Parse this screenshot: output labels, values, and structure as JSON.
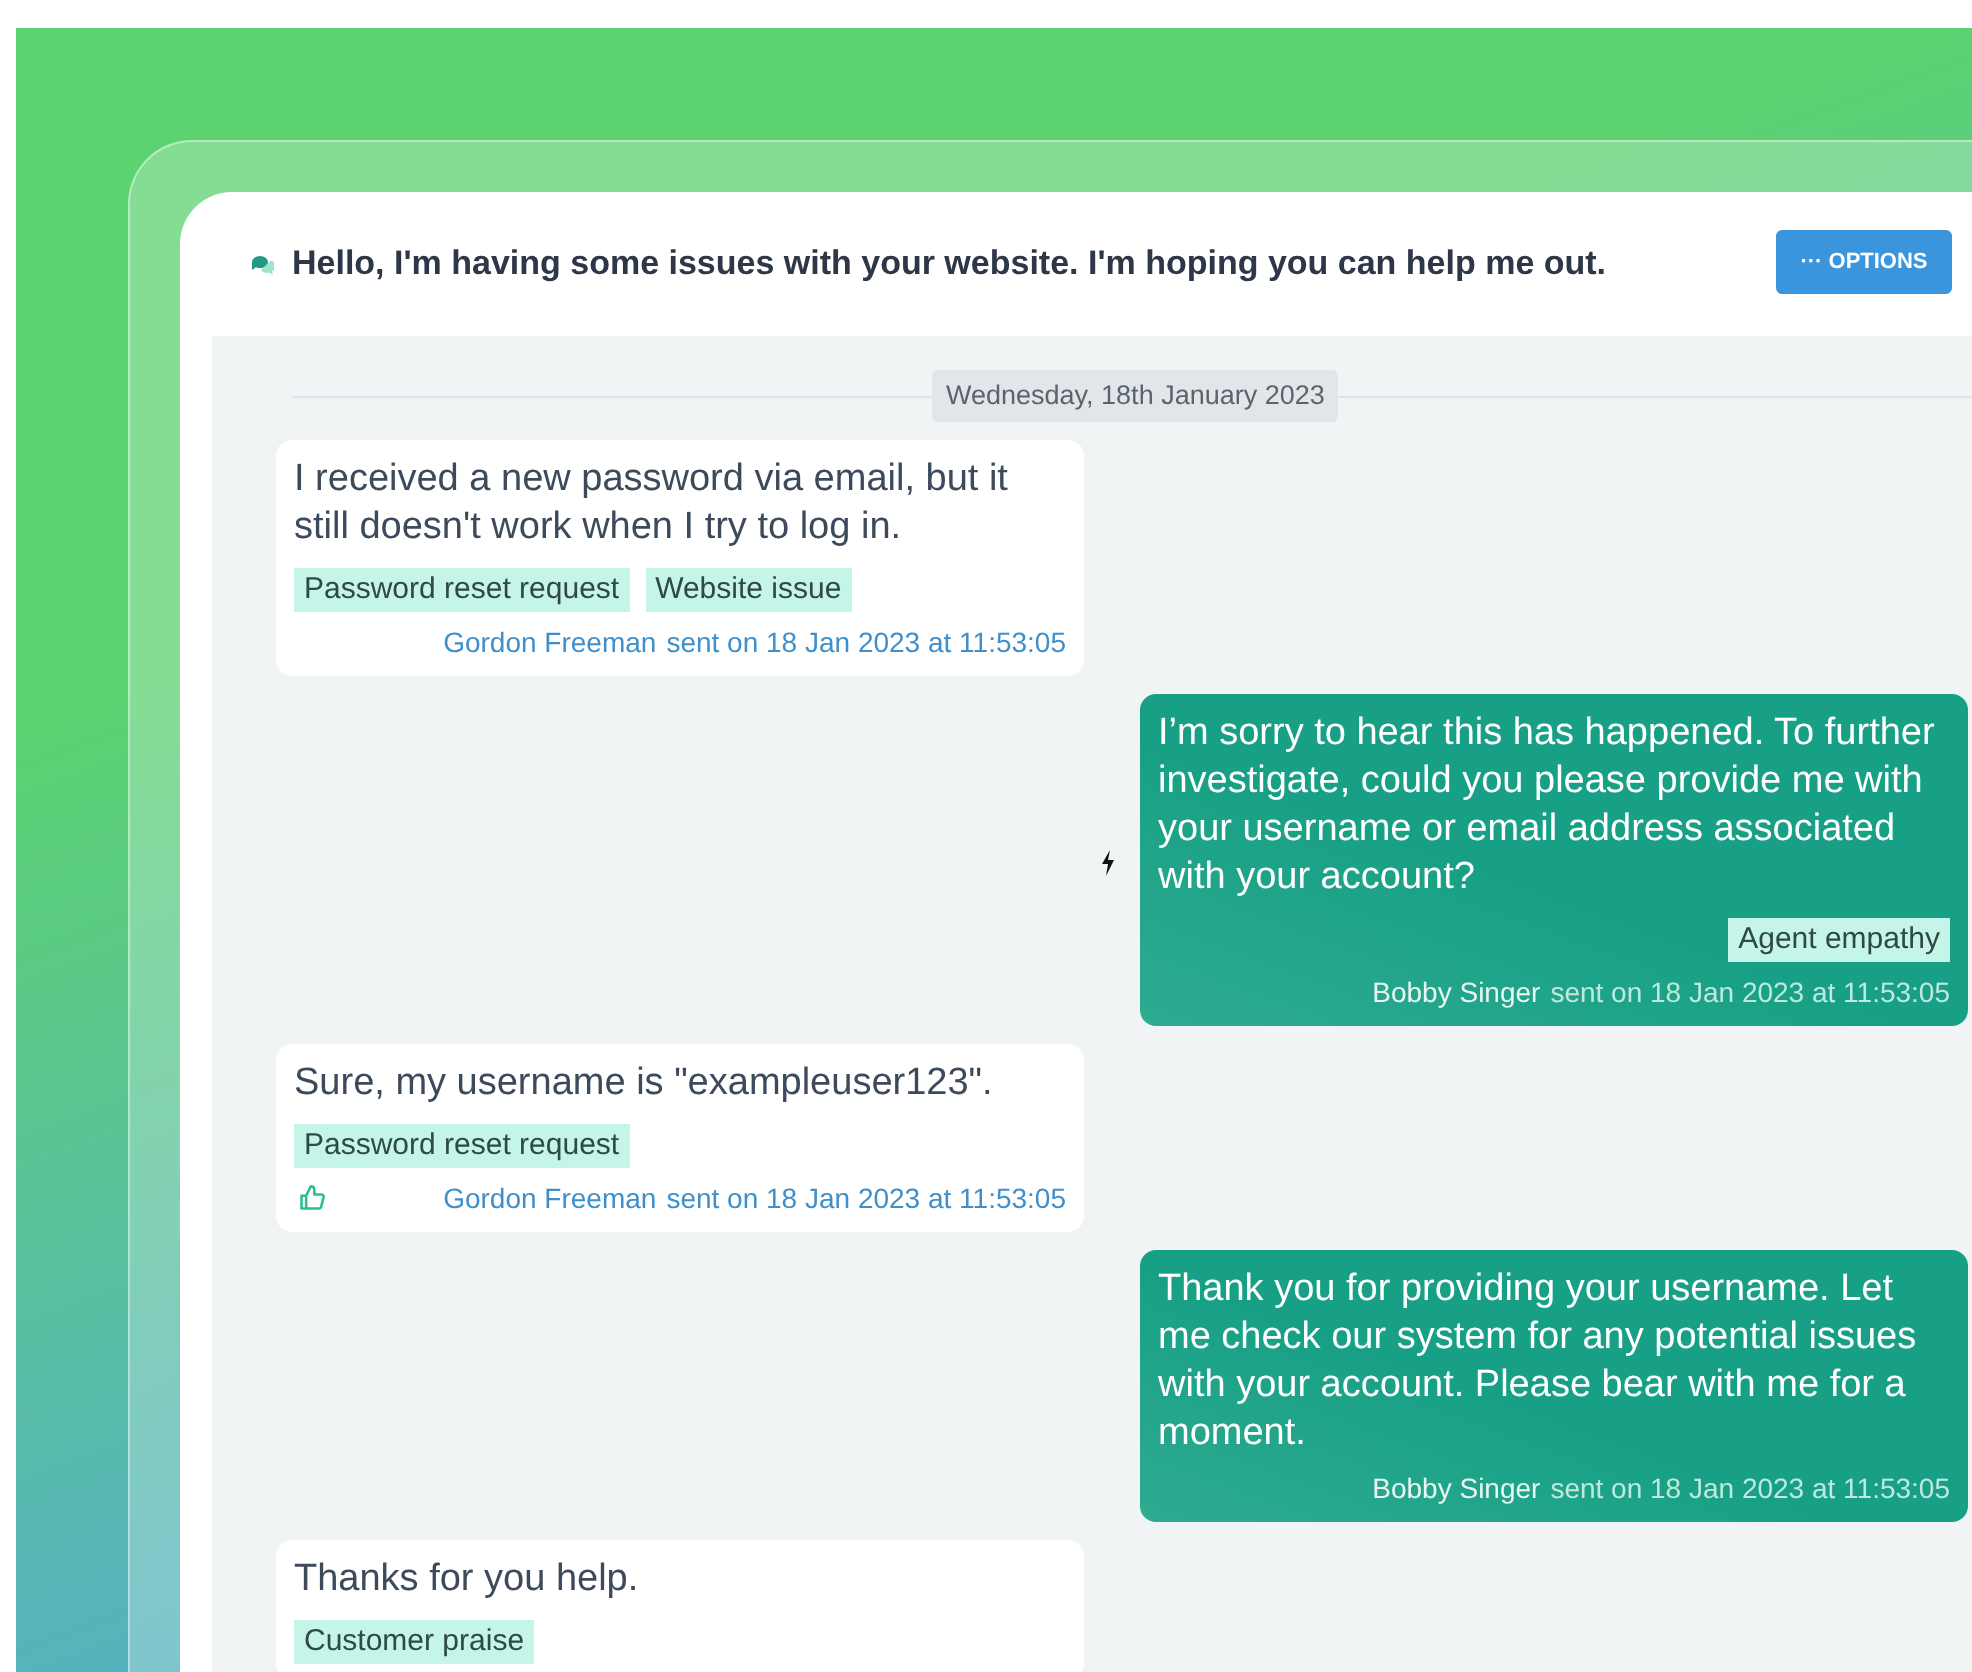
{
  "header": {
    "title": "Hello, I'm having some issues with your website. I'm hoping you can help me out.",
    "options_button": "··· OPTIONS"
  },
  "date_separator": "Wednesday, 18th January 2023",
  "messages": [
    {
      "kind": "customer",
      "text": "I received a new password via email, but it still doesn't work when I try to log in.",
      "tags": [
        "Password reset request",
        "Website issue"
      ],
      "author": "Gordon Freeman",
      "sent": "sent on 18 Jan 2023 at 11:53:05",
      "liked": false,
      "flagged": false
    },
    {
      "kind": "agent",
      "text": "I’m sorry to hear this has happened. To further investigate, could you please provide me with your username or email address associated with your account?",
      "tags": [
        "Agent empathy"
      ],
      "author": "Bobby Singer",
      "sent": "sent on 18 Jan 2023 at 11:53:05",
      "liked": false,
      "flagged": true
    },
    {
      "kind": "customer",
      "text": "Sure, my username is \"exampleuser123\".",
      "tags": [
        "Password reset request"
      ],
      "author": "Gordon Freeman",
      "sent": "sent on 18 Jan 2023 at 11:53:05",
      "liked": true,
      "flagged": false
    },
    {
      "kind": "agent",
      "text": "Thank you for providing your username. Let me check our system for any potential issues with your account. Please bear with me for a moment.",
      "author": "Bobby Singer",
      "sent": "sent on 18 Jan 2023 at 11:53:05",
      "liked": false,
      "flagged": false
    },
    {
      "kind": "customer",
      "text": "Thanks for you help.",
      "tags": [
        "Customer praise"
      ],
      "liked": false,
      "flagged": false
    }
  ]
}
